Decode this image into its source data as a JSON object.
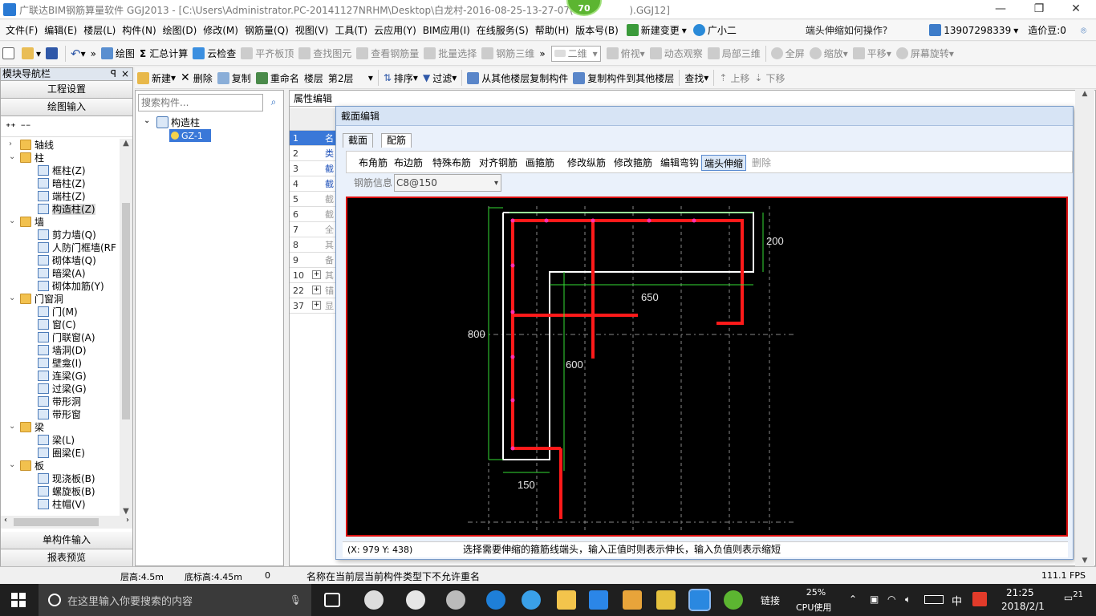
{
  "titlebar": {
    "title": "广联达BIM钢筋算量软件 GGJ2013 - [C:\\Users\\Administrator.PC-20141127NRHM\\Desktop\\白龙村-2016-08-25-13-27-07(2",
    "title_tail": ").GGJ12]",
    "badge": "70",
    "minimize": "—",
    "restore": "❐",
    "close": "✕"
  },
  "menubar": {
    "items": [
      "文件(F)",
      "编辑(E)",
      "楼层(L)",
      "构件(N)",
      "绘图(D)",
      "修改(M)",
      "钢筋量(Q)",
      "视图(V)",
      "工具(T)",
      "云应用(Y)",
      "BIM应用(I)",
      "在线服务(S)",
      "帮助(H)",
      "版本号(B)"
    ],
    "new_change": "新建变更",
    "guang_xiaoer": "广小二",
    "help_question": "端头伸缩如何操作?",
    "phone": "13907298339",
    "price_bean": "造价豆:0"
  },
  "toolbar1": {
    "draw": "绘图",
    "sum": "汇总计算",
    "cloud_check": "云检查",
    "flat_top": "平齐板顶",
    "find_element": "查找图元",
    "view_rebar": "查看钢筋量",
    "batch_select": "批量选择",
    "rebar_3d": "钢筋三维",
    "view_mode": "二维",
    "top_view": "俯视",
    "dynamic_observe": "动态观察",
    "local_3d": "局部三维",
    "fullscreen": "全屏",
    "zoom": "缩放",
    "pan": "平移",
    "rotate": "屏幕旋转"
  },
  "toolbar2": {
    "new": "新建",
    "delete": "删除",
    "copy": "复制",
    "rename": "重命名",
    "floor_label": "楼层",
    "floor_value": "第2层",
    "sort": "排序",
    "filter": "过滤",
    "copy_from": "从其他楼层复制构件",
    "copy_to": "复制构件到其他楼层",
    "find": "查找",
    "move_up": "上移",
    "move_down": "下移"
  },
  "nav": {
    "header": "模块导航栏",
    "pin": "ꟼ",
    "close": "×",
    "project_settings": "工程设置",
    "drawing_input": "绘图输入",
    "single_input": "单构件输入",
    "report_preview": "报表预览",
    "tree": [
      {
        "label": "轴线",
        "level": 0,
        "exp": "›",
        "icon": "folder"
      },
      {
        "label": "柱",
        "level": 0,
        "exp": "⌄",
        "icon": "folder"
      },
      {
        "label": "框柱(Z)",
        "level": 1,
        "icon": "comp"
      },
      {
        "label": "暗柱(Z)",
        "level": 1,
        "icon": "comp"
      },
      {
        "label": "端柱(Z)",
        "level": 1,
        "icon": "comp"
      },
      {
        "label": "构造柱(Z)",
        "level": 1,
        "icon": "comp",
        "selected": true
      },
      {
        "label": "墙",
        "level": 0,
        "exp": "⌄",
        "icon": "folder"
      },
      {
        "label": "剪力墙(Q)",
        "level": 1,
        "icon": "comp"
      },
      {
        "label": "人防门框墙(RF",
        "level": 1,
        "icon": "comp"
      },
      {
        "label": "砌体墙(Q)",
        "level": 1,
        "icon": "comp"
      },
      {
        "label": "暗梁(A)",
        "level": 1,
        "icon": "comp"
      },
      {
        "label": "砌体加筋(Y)",
        "level": 1,
        "icon": "comp"
      },
      {
        "label": "门窗洞",
        "level": 0,
        "exp": "⌄",
        "icon": "folder"
      },
      {
        "label": "门(M)",
        "level": 1,
        "icon": "comp"
      },
      {
        "label": "窗(C)",
        "level": 1,
        "icon": "comp"
      },
      {
        "label": "门联窗(A)",
        "level": 1,
        "icon": "comp"
      },
      {
        "label": "墙洞(D)",
        "level": 1,
        "icon": "comp"
      },
      {
        "label": "壁龛(I)",
        "level": 1,
        "icon": "comp"
      },
      {
        "label": "连梁(G)",
        "level": 1,
        "icon": "comp"
      },
      {
        "label": "过梁(G)",
        "level": 1,
        "icon": "comp"
      },
      {
        "label": "带形洞",
        "level": 1,
        "icon": "comp"
      },
      {
        "label": "带形窗",
        "level": 1,
        "icon": "comp"
      },
      {
        "label": "梁",
        "level": 0,
        "exp": "⌄",
        "icon": "folder"
      },
      {
        "label": "梁(L)",
        "level": 1,
        "icon": "comp"
      },
      {
        "label": "圈梁(E)",
        "level": 1,
        "icon": "comp"
      },
      {
        "label": "板",
        "level": 0,
        "exp": "⌄",
        "icon": "folder"
      },
      {
        "label": "现浇板(B)",
        "level": 1,
        "icon": "comp"
      },
      {
        "label": "螺旋板(B)",
        "level": 1,
        "icon": "comp"
      },
      {
        "label": "柱帽(V)",
        "level": 1,
        "icon": "comp"
      }
    ]
  },
  "complist": {
    "search_placeholder": "搜索构件...",
    "root": "构造柱",
    "item": "GZ-1"
  },
  "propgrid": {
    "tab": "属性编辑",
    "rows": [
      {
        "n": "1",
        "c": "名"
      },
      {
        "n": "2",
        "c": "类"
      },
      {
        "n": "3",
        "c": "截"
      },
      {
        "n": "4",
        "c": "截"
      },
      {
        "n": "5",
        "c": "截"
      },
      {
        "n": "6",
        "c": "截"
      },
      {
        "n": "7",
        "c": "全"
      },
      {
        "n": "8",
        "c": "其"
      },
      {
        "n": "9",
        "c": "备"
      },
      {
        "n": "10",
        "c": "其"
      },
      {
        "n": "22",
        "c": "锚"
      },
      {
        "n": "37",
        "c": "显"
      }
    ]
  },
  "dialog": {
    "title": "截面编辑",
    "tab_section": "截面",
    "tab_rebar": "配筋",
    "tools": [
      "布角筋",
      "布边筋",
      "特殊布筋",
      "对齐钢筋",
      "画箍筋",
      "修改纵筋",
      "修改箍筋",
      "编辑弯钩",
      "端头伸缩",
      "删除"
    ],
    "rebar_info_label": "钢筋信息",
    "rebar_info_value": "C8@150",
    "coord": "(X: 979 Y: 438)",
    "hint": "选择需要伸缩的箍筋线端头，输入正值时则表示伸长，输入负值则表示缩短",
    "dims": {
      "d200": "200",
      "d650": "650",
      "d800": "800",
      "d600": "600",
      "d150": "150"
    }
  },
  "statusbar": {
    "floor_height": "层高:4.5m",
    "bottom_elev": "底标高:4.45m",
    "zero": "0",
    "message": "名称在当前层当前构件类型下不允许重名",
    "fps": "111.1 FPS"
  },
  "taskbar": {
    "search_placeholder": "在这里输入你要搜索的内容",
    "link": "链接",
    "cpu": "25%",
    "cpu_label": "CPU使用",
    "ime": "中",
    "time": "21:25",
    "date": "2018/2/1",
    "notif": "21"
  },
  "colors": {
    "rebar": "#ff1a1a",
    "outline": "#ffffff",
    "dim": "#33dd33",
    "axis": "#888888",
    "border": "#dd1111"
  }
}
